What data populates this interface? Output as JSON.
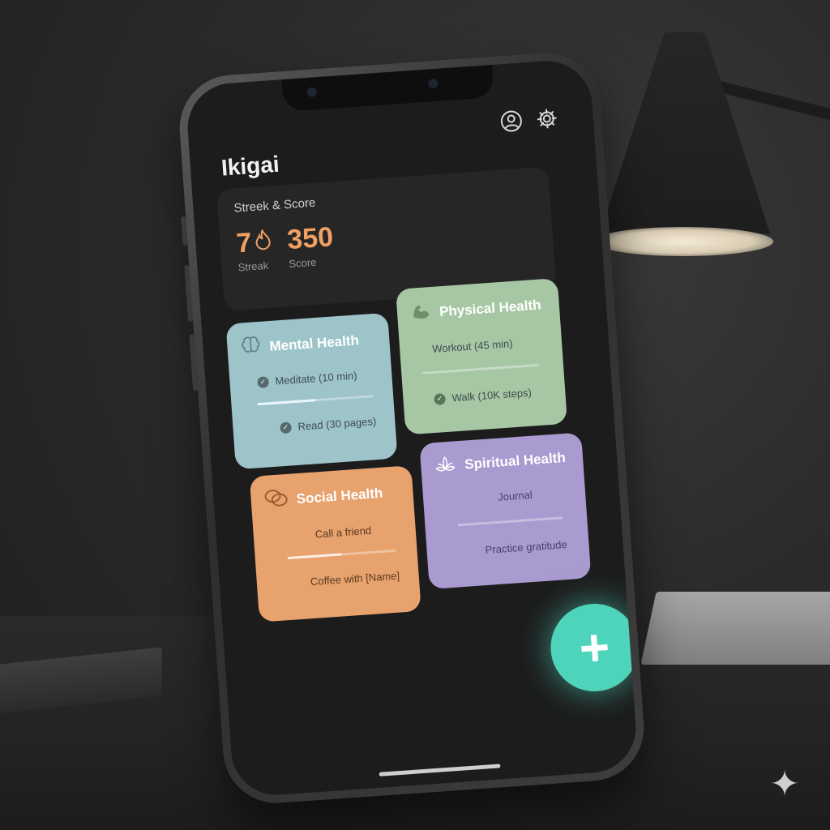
{
  "app": {
    "title": "Ikigai"
  },
  "header": {
    "icons": [
      "profile-icon",
      "settings-icon"
    ]
  },
  "score_card": {
    "label": "Streek & Score",
    "streak_value": "7",
    "streak_label": "Streak",
    "score_value": "350",
    "score_label": "Score"
  },
  "categories": [
    {
      "title": "Mental Health",
      "icon": "brain-icon",
      "color": "#9cc4c9",
      "tasks": [
        "Meditate (10 min)",
        "Read (30 pages)"
      ],
      "progress": 0.5
    },
    {
      "title": "Physical Health",
      "icon": "muscle-icon",
      "color": "#a7c7a4",
      "tasks": [
        "Workout (45 min)",
        "Walk (10K steps)"
      ],
      "progress": 0.0
    },
    {
      "title": "Social Health",
      "icon": "chat-bubbles-icon",
      "color": "#e7a26d",
      "tasks": [
        "Call a friend",
        "Coffee with [Name]"
      ],
      "progress": 0.5
    },
    {
      "title": "Spiritual Health",
      "icon": "lotus-icon",
      "color": "#a99ad0",
      "tasks": [
        "Journal",
        "Practice gratitude"
      ],
      "progress": 0.0
    }
  ],
  "fab": {
    "label": "+",
    "icon": "plus-icon",
    "color": "#4fd4bc"
  },
  "accent_colors": {
    "streak": "#f0a063",
    "fab": "#4fd4bc"
  }
}
